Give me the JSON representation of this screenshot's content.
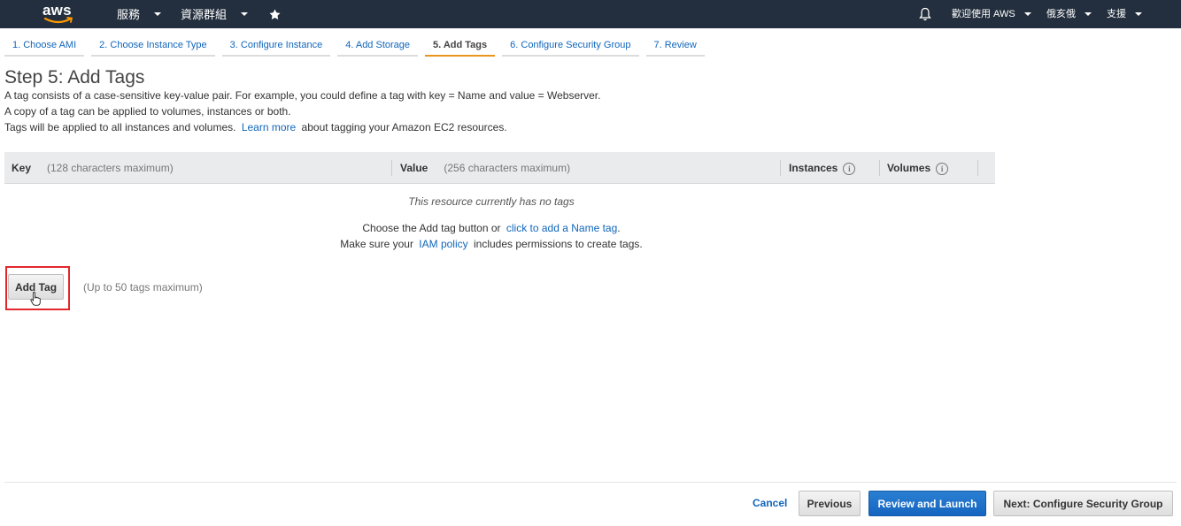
{
  "topnav": {
    "logo_text": "aws",
    "services_label": "服務",
    "resource_groups_label": "資源群組",
    "pin_icon": "pin-icon",
    "bell_icon": "bell-icon",
    "account_label": "歡迎使用 AWS",
    "region_label": "俄亥俄",
    "support_label": "支援"
  },
  "wizard_tabs": [
    {
      "label": "1. Choose AMI",
      "active": false
    },
    {
      "label": "2. Choose Instance Type",
      "active": false
    },
    {
      "label": "3. Configure Instance",
      "active": false
    },
    {
      "label": "4. Add Storage",
      "active": false
    },
    {
      "label": "5. Add Tags",
      "active": true
    },
    {
      "label": "6. Configure Security Group",
      "active": false
    },
    {
      "label": "7. Review",
      "active": false
    }
  ],
  "page": {
    "title": "Step 5: Add Tags",
    "desc_line1": "A tag consists of a case-sensitive key-value pair. For example, you could define a tag with key = Name and value = Webserver.",
    "desc_line2": "A copy of a tag can be applied to volumes, instances or both.",
    "desc_line3_before": "Tags will be applied to all instances and volumes.",
    "learn_more": "Learn more",
    "desc_line3_after": "about tagging your Amazon EC2 resources."
  },
  "table": {
    "key_header": "Key",
    "key_hint": "(128 characters maximum)",
    "value_header": "Value",
    "value_hint": "(256 characters maximum)",
    "instances_header": "Instances",
    "volumes_header": "Volumes",
    "info_glyph": "i",
    "empty_text": "This resource currently has no tags",
    "choose_before": "Choose the Add tag button or",
    "choose_link": "click to add a Name tag",
    "choose_after": ".",
    "iam_before": "Make sure your",
    "iam_link": "IAM policy",
    "iam_after": "includes permissions to create tags."
  },
  "add_tag": {
    "button_label": "Add Tag",
    "limit_text": "(Up to 50 tags maximum)"
  },
  "footer": {
    "cancel_label": "Cancel",
    "previous_label": "Previous",
    "review_launch_label": "Review and Launch",
    "next_label": "Next: Configure Security Group"
  },
  "colors": {
    "nav_bg": "#232f3e",
    "link": "#1166bb",
    "active_tab_underline": "#e8961c",
    "highlight": "#e4262b",
    "primary_button": "#1565c0"
  }
}
